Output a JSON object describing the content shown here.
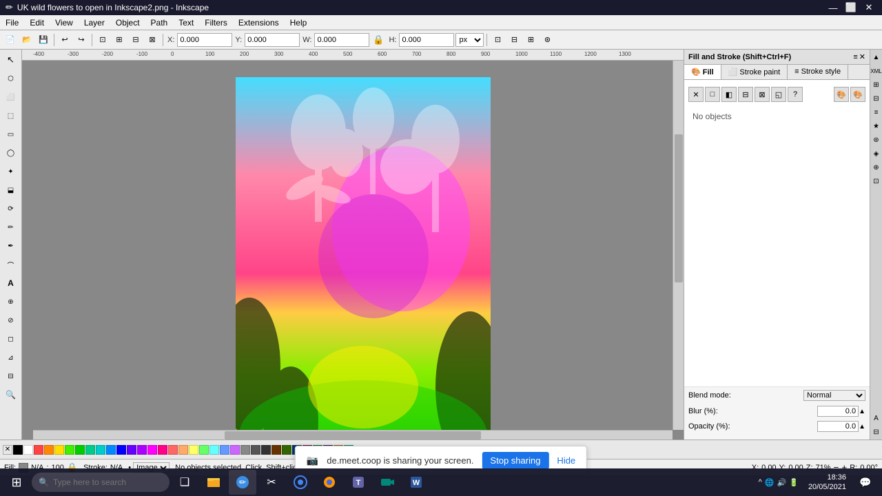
{
  "window": {
    "title": "UK wild flowers to open in Inkscape2.png - Inkscape",
    "icon": "inkscape"
  },
  "titlebar": {
    "minimize": "—",
    "maximize": "⬜",
    "close": "✕"
  },
  "menubar": {
    "items": [
      "File",
      "Edit",
      "View",
      "Layer",
      "Object",
      "Path",
      "Text",
      "Filters",
      "Extensions",
      "Help"
    ]
  },
  "toolbar": {
    "x_label": "X:",
    "x_value": "0.000",
    "y_label": "Y:",
    "y_value": "0.000",
    "w_label": "W:",
    "w_value": "0.000",
    "h_label": "H:",
    "h_value": "0.000",
    "units": "px"
  },
  "tools": [
    {
      "name": "select",
      "icon": "↖"
    },
    {
      "name": "node",
      "icon": "⬡"
    },
    {
      "name": "zoom",
      "icon": "⬜"
    },
    {
      "name": "measure",
      "icon": "⬚"
    },
    {
      "name": "rectangle",
      "icon": "▭"
    },
    {
      "name": "ellipse",
      "icon": "◯"
    },
    {
      "name": "star",
      "icon": "✦"
    },
    {
      "name": "3d-box",
      "icon": "⬓"
    },
    {
      "name": "spiral",
      "icon": "🌀"
    },
    {
      "name": "pencil",
      "icon": "✏"
    },
    {
      "name": "pen",
      "icon": "✒"
    },
    {
      "name": "calligraphy",
      "icon": "⌒"
    },
    {
      "name": "text",
      "icon": "A"
    },
    {
      "name": "spray",
      "icon": "⊕"
    },
    {
      "name": "paint-bucket",
      "icon": "⊘"
    },
    {
      "name": "gradient",
      "icon": "◻"
    },
    {
      "name": "dropper",
      "icon": "⊿"
    },
    {
      "name": "connector",
      "icon": "⊟"
    },
    {
      "name": "zoom-tool",
      "icon": "🔍"
    }
  ],
  "panel": {
    "title": "Fill and Stroke (Shift+Ctrl+F)",
    "tabs": [
      {
        "label": "Fill",
        "id": "fill",
        "active": true
      },
      {
        "label": "Stroke paint",
        "id": "stroke-paint",
        "active": false
      },
      {
        "label": "Stroke style",
        "id": "stroke-style",
        "active": false
      }
    ],
    "no_objects": "No objects",
    "blend_label": "Blend mode:",
    "blend_value": "Normal",
    "blur_label": "Blur (%):",
    "blur_value": "0.0",
    "opacity_label": "Opacity (%):",
    "opacity_value": "0.0",
    "fill_buttons": [
      "✕",
      "□",
      "■",
      "◧",
      "⊟",
      "⊠",
      "◱",
      "?"
    ],
    "color_icon1": "🎨",
    "color_icon2": "🎨"
  },
  "statusbar": {
    "fill_label": "Fill:",
    "fill_value": "N/A",
    "opacity_label": "100",
    "stroke_label": "Stroke:",
    "stroke_value": "N/A",
    "image_mode": "Image",
    "status_message": "No objects selected. Click, Shift+click, Alt",
    "coords_x_label": "X:",
    "coords_x_value": "0.00",
    "coords_y_label": "Y:",
    "coords_y_value": "0.00",
    "zoom_label": "Z:",
    "zoom_value": "71%",
    "rotation_label": "R:",
    "rotation_value": "0.00°"
  },
  "sharing": {
    "icon": "📷",
    "message": "de.meet.coop is sharing your screen.",
    "stop_button": "Stop sharing",
    "hide_button": "Hide"
  },
  "taskbar": {
    "search_placeholder": "Type here to search",
    "time": "18:36",
    "date": "20/05/2021",
    "apps": [
      {
        "name": "windows-start",
        "icon": "⊞"
      },
      {
        "name": "search-taskbar",
        "icon": "🔍"
      },
      {
        "name": "task-view",
        "icon": "❑"
      },
      {
        "name": "file-explorer",
        "icon": "📁"
      },
      {
        "name": "inkscape-task",
        "icon": "✏"
      },
      {
        "name": "chrome",
        "icon": "◉"
      },
      {
        "name": "firefox",
        "icon": "🦊"
      },
      {
        "name": "teams",
        "icon": "T"
      },
      {
        "name": "meet",
        "icon": "M"
      },
      {
        "name": "word",
        "icon": "W"
      }
    ]
  },
  "colors": {
    "no_color": "X",
    "swatches": [
      "#000000",
      "#ffffff",
      "#ff0000",
      "#00ff00",
      "#0000ff",
      "#ffff00",
      "#ff00ff",
      "#00ffff",
      "#ff8800",
      "#8800ff",
      "#00ff88",
      "#ff0088",
      "#888888",
      "#444444",
      "#cccccc",
      "#ff4444",
      "#44ff44",
      "#4444ff",
      "#ffaa00",
      "#aa00ff",
      "#00ffaa",
      "#ff00aa",
      "#663300",
      "#336600",
      "#003366",
      "#660033",
      "#006633",
      "#330066",
      "#996600",
      "#009966"
    ]
  }
}
